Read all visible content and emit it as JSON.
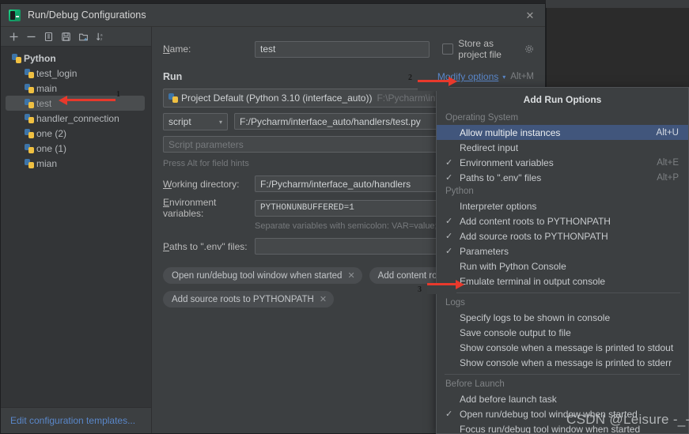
{
  "window": {
    "title": "Run/Debug Configurations",
    "close_label": "✕",
    "app_icon": "pycharm-icon"
  },
  "sidebar": {
    "toolbar": [
      {
        "name": "add-configuration-button",
        "icon": "plus-icon"
      },
      {
        "name": "remove-configuration-button",
        "icon": "minus-icon"
      },
      {
        "name": "copy-configuration-button",
        "icon": "copy-icon"
      },
      {
        "name": "save-configuration-button",
        "icon": "save-icon"
      },
      {
        "name": "new-folder-button",
        "icon": "new-folder-icon"
      },
      {
        "name": "sort-configurations-button",
        "icon": "sort-az-icon"
      }
    ],
    "group": {
      "label": "Python",
      "caret": "⌄"
    },
    "items": [
      {
        "label": "test_login",
        "selected": false
      },
      {
        "label": "main",
        "selected": false
      },
      {
        "label": "test",
        "selected": true
      },
      {
        "label": "handler_connection",
        "selected": false
      },
      {
        "label": "one (2)",
        "selected": false
      },
      {
        "label": "one (1)",
        "selected": false
      },
      {
        "label": "mian",
        "selected": false
      }
    ],
    "footer_link": "Edit configuration templates..."
  },
  "form": {
    "name_label": "Name:",
    "name_value": "test",
    "store_as_project_file_label": "Store as project file",
    "store_as_project_file_checked": false,
    "gear_icon": "gear-icon",
    "run_section_title": "Run",
    "modify_options_label": "Modify options",
    "modify_options_shortcut": "Alt+M",
    "interpreter_value": "Project Default (Python 3.10 (interface_auto))",
    "interpreter_path_dim": "F:\\Pycharm\\interface_aut",
    "target_type": "script",
    "script_path": "F:/Pycharm/interface_auto/handlers/test.py",
    "script_parameters_placeholder": "Script parameters",
    "field_hint": "Press Alt for field hints",
    "working_directory_label": "Working directory:",
    "working_directory_value": "F:/Pycharm/interface_auto/handlers",
    "environment_variables_label": "Environment variables:",
    "environment_variables_value": "PYTHONUNBUFFERED=1",
    "environment_variables_hint": "Separate variables with semicolon: VAR=value; VAR",
    "env_paths_label": "Paths to \".env\" files:",
    "env_paths_value": "",
    "chips": [
      {
        "label": "Open run/debug tool window when started",
        "close": "✕"
      },
      {
        "label": "Add content roots",
        "close": ""
      },
      {
        "label": "Add source roots to PYTHONPATH",
        "close": "✕"
      }
    ]
  },
  "menu": {
    "title": "Add Run Options",
    "groups": [
      {
        "header": "Operating System",
        "items": [
          {
            "label": "Allow multiple instances",
            "checked": false,
            "shortcut": "Alt+U",
            "highlighted": true
          },
          {
            "label": "Redirect input",
            "checked": false,
            "shortcut": "",
            "highlighted": false
          },
          {
            "label": "Environment variables",
            "checked": true,
            "shortcut": "Alt+E",
            "highlighted": false
          },
          {
            "label": "Paths to \".env\" files",
            "checked": true,
            "shortcut": "Alt+P",
            "highlighted": false
          }
        ],
        "separator_after": false
      },
      {
        "header": "Python",
        "items": [
          {
            "label": "Interpreter options",
            "checked": false,
            "shortcut": "",
            "highlighted": false
          },
          {
            "label": "Add content roots to PYTHONPATH",
            "checked": true,
            "shortcut": "",
            "highlighted": false
          },
          {
            "label": "Add source roots to PYTHONPATH",
            "checked": true,
            "shortcut": "",
            "highlighted": false
          },
          {
            "label": "Parameters",
            "checked": true,
            "shortcut": "",
            "highlighted": false
          },
          {
            "label": "Run with Python Console",
            "checked": false,
            "shortcut": "",
            "highlighted": false
          },
          {
            "label": "Emulate terminal in output console",
            "checked": false,
            "shortcut": "",
            "highlighted": false
          }
        ],
        "separator_after": true
      },
      {
        "header": "Logs",
        "items": [
          {
            "label": "Specify logs to be shown in console",
            "checked": false,
            "shortcut": "",
            "highlighted": false
          },
          {
            "label": "Save console output to file",
            "checked": false,
            "shortcut": "",
            "highlighted": false
          },
          {
            "label": "Show console when a message is printed to stdout",
            "checked": false,
            "shortcut": "",
            "highlighted": false
          },
          {
            "label": "Show console when a message is printed to stderr",
            "checked": false,
            "shortcut": "",
            "highlighted": false
          }
        ],
        "separator_after": true
      },
      {
        "header": "Before Launch",
        "items": [
          {
            "label": "Add before launch task",
            "checked": false,
            "shortcut": "",
            "highlighted": false
          },
          {
            "label": "Open run/debug tool window when started",
            "checked": true,
            "shortcut": "",
            "highlighted": false
          },
          {
            "label": "Focus run/debug tool window when started",
            "checked": false,
            "shortcut": "",
            "highlighted": false
          }
        ],
        "separator_after": false
      }
    ],
    "check_glyph": "✓"
  },
  "annotations": [
    {
      "number": "1",
      "target": "sidebar-item-test"
    },
    {
      "number": "2",
      "target": "modify-options-link"
    },
    {
      "number": "3",
      "target": "emulate-terminal-menu-item"
    }
  ],
  "watermark": "CSDN @Leisure -_-",
  "colors": {
    "accent_link": "#5a87c9",
    "menu_highlight": "#41567c",
    "annotation_red": "#e8392c",
    "dialog_bg": "#3c3f41",
    "tree_bg": "#333537"
  }
}
